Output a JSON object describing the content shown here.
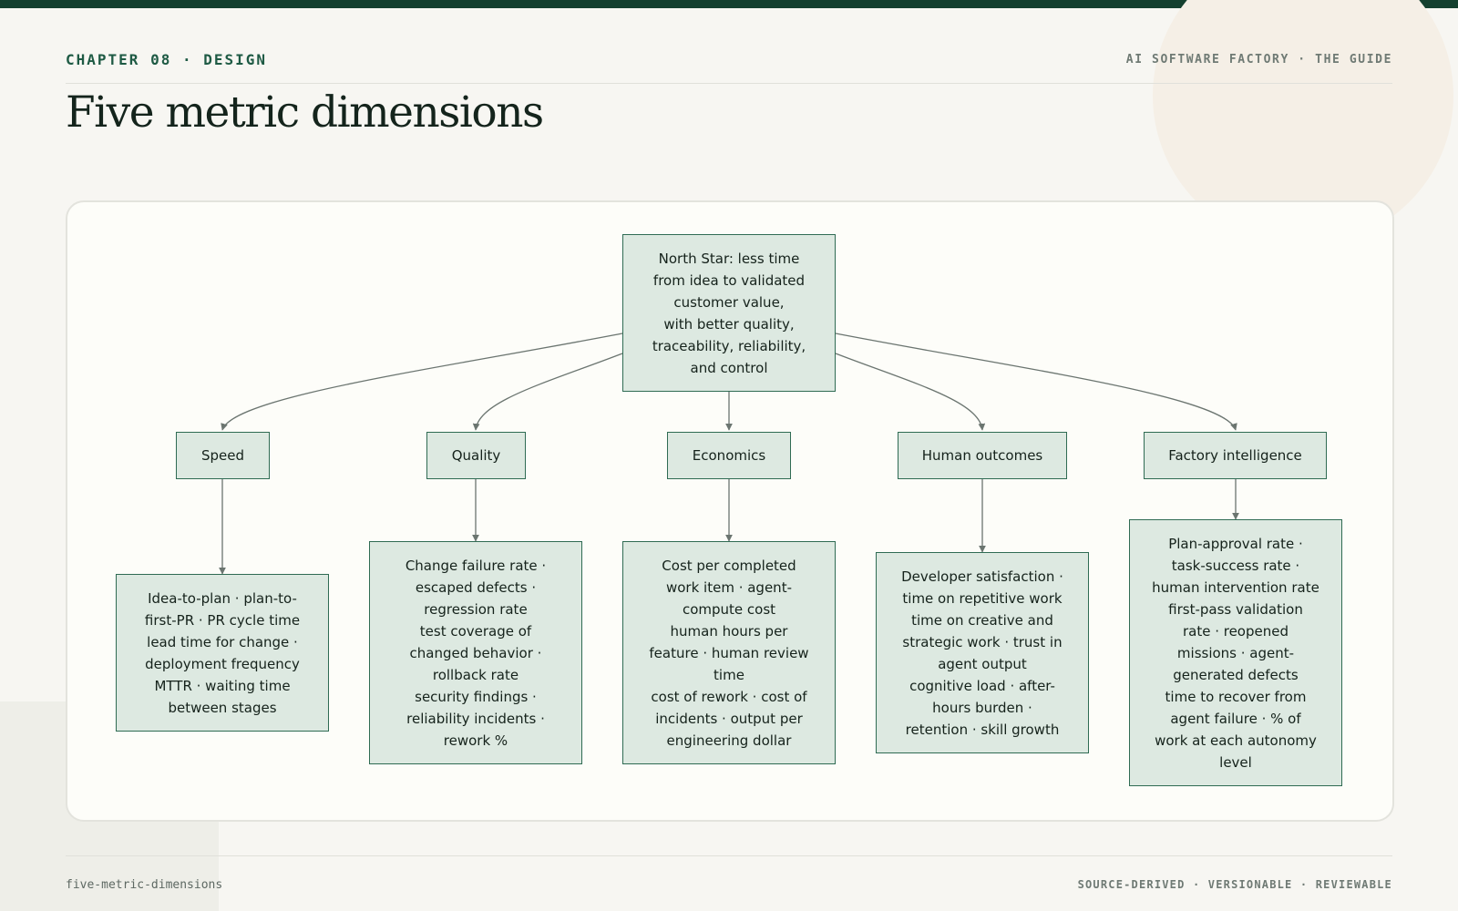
{
  "header": {
    "chapter": "CHAPTER 08 · DESIGN",
    "guide": "AI SOFTWARE FACTORY · THE GUIDE",
    "title": "Five metric dimensions"
  },
  "diagram": {
    "root": "North Star: less time\nfrom idea to validated\ncustomer value,\nwith better quality,\ntraceability, reliability,\nand control",
    "dimensions": [
      {
        "label": "Speed",
        "detail": "Idea-to-plan · plan-to-\nfirst-PR · PR cycle time\nlead time for change ·\ndeployment frequency\nMTTR · waiting time\nbetween stages"
      },
      {
        "label": "Quality",
        "detail": "Change failure rate ·\nescaped defects ·\nregression rate\ntest coverage of\nchanged behavior ·\nrollback rate\nsecurity findings ·\nreliability incidents ·\nrework %"
      },
      {
        "label": "Economics",
        "detail": "Cost per completed\nwork item · agent-\ncompute cost\nhuman hours per\nfeature · human review\ntime\ncost of rework · cost of\nincidents · output per\nengineering dollar"
      },
      {
        "label": "Human outcomes",
        "detail": "Developer satisfaction ·\ntime on repetitive work\ntime on creative and\nstrategic work · trust in\nagent output\ncognitive load · after-\nhours burden ·\nretention · skill growth"
      },
      {
        "label": "Factory intelligence",
        "detail": "Plan-approval rate ·\ntask-success rate ·\nhuman intervention rate\nfirst-pass validation\nrate · reopened\nmissions · agent-\ngenerated defects\ntime to recover from\nagent failure · % of\nwork at each autonomy\nlevel"
      }
    ]
  },
  "footer": {
    "slug": "five-metric-dimensions",
    "tags": "SOURCE-DERIVED · VERSIONABLE · REVIEWABLE"
  },
  "colors": {
    "brand_dark": "#14402f",
    "accent_green": "#1e5a44",
    "node_fill": "#dde9e1",
    "node_border": "#2f6b53",
    "edge": "#6b7570"
  }
}
